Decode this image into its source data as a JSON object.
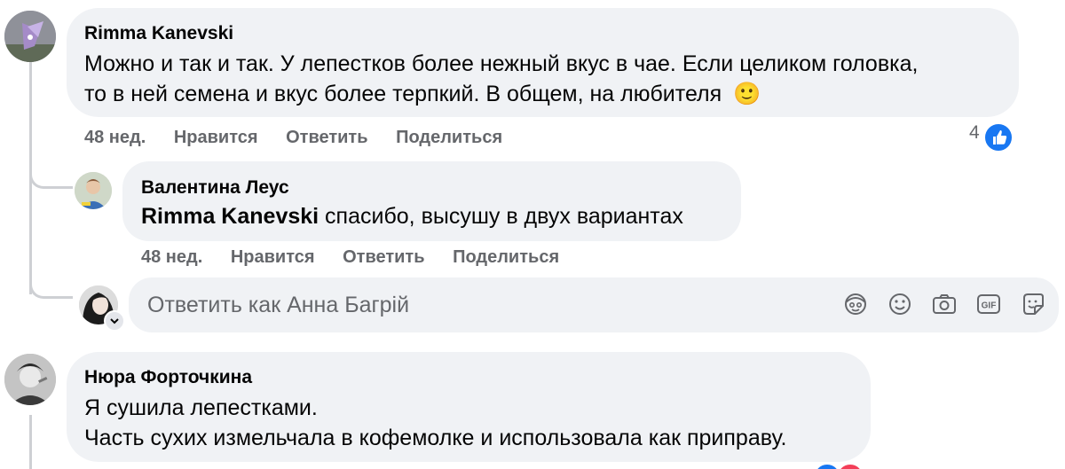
{
  "comments": [
    {
      "author": "Rimma Kanevski",
      "lines": [
        "Можно и так и так. У лепестков более нежный вкус в чае. Если целиком головка,",
        "то в ней семена и вкус более терпкий. В общем, на любителя"
      ],
      "emoji": "🙂",
      "age": "48 нед.",
      "like": "Нравится",
      "reply": "Ответить",
      "share": "Поделиться",
      "reaction_count": "4",
      "reply_item": {
        "author": "Валентина Леус",
        "mention": "Rimma Kanevski",
        "text": " спасибо, высушу в двух вариантах",
        "age": "48 нед.",
        "like": "Нравится",
        "reply": "Ответить",
        "share": "Поделиться"
      },
      "reply_box": {
        "placeholder": "Ответить как Анна Багрій"
      }
    },
    {
      "author": "Нюра Форточкина",
      "lines": [
        "Я сушила лепестками.",
        "Часть сухих измельчала в кофемолке и использовала как приправу."
      ]
    }
  ],
  "colors": {
    "bubble": "#f0f2f5",
    "meta": "#65676b",
    "like_blue": "#1877f2",
    "thread_line": "#ced0d4"
  },
  "icons": [
    "avatar-emoji-icon",
    "emoji-icon",
    "camera-icon",
    "gif-icon",
    "sticker-icon",
    "like-thumb-icon"
  ]
}
